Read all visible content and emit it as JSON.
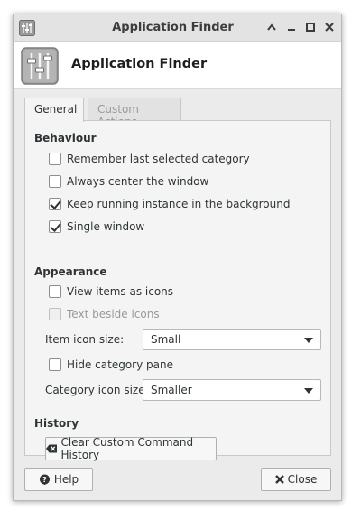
{
  "window": {
    "title": "Application Finder",
    "header_title": "Application Finder",
    "controls": [
      "shade-up-icon",
      "minimize-icon",
      "maximize-icon",
      "close-icon"
    ]
  },
  "tabs": [
    {
      "label": "General",
      "active": true
    },
    {
      "label": "Custom Actions",
      "active": false
    }
  ],
  "behaviour": {
    "heading": "Behaviour",
    "options": [
      {
        "label": "Remember last selected category",
        "checked": false
      },
      {
        "label": "Always center the window",
        "checked": false
      },
      {
        "label": "Keep running instance in the background",
        "checked": true
      },
      {
        "label": "Single window",
        "checked": true
      }
    ]
  },
  "appearance": {
    "heading": "Appearance",
    "view_as_icons": {
      "label": "View items as icons",
      "checked": false
    },
    "text_beside_icons": {
      "label": "Text beside icons",
      "checked": false,
      "disabled": true
    },
    "item_icon_size": {
      "label": "Item icon size:",
      "value": "Small"
    },
    "hide_category_pane": {
      "label": "Hide category pane",
      "checked": false
    },
    "category_icon_size": {
      "label": "Category icon size:",
      "value": "Smaller"
    }
  },
  "history": {
    "heading": "History",
    "clear_button": "Clear Custom Command History"
  },
  "footer": {
    "help": "Help",
    "close": "Close"
  },
  "colors": {
    "window_bg": "#ebebeb",
    "panel_bg": "#f4f4f4",
    "titlebar_bg": "#e3e3e3"
  }
}
